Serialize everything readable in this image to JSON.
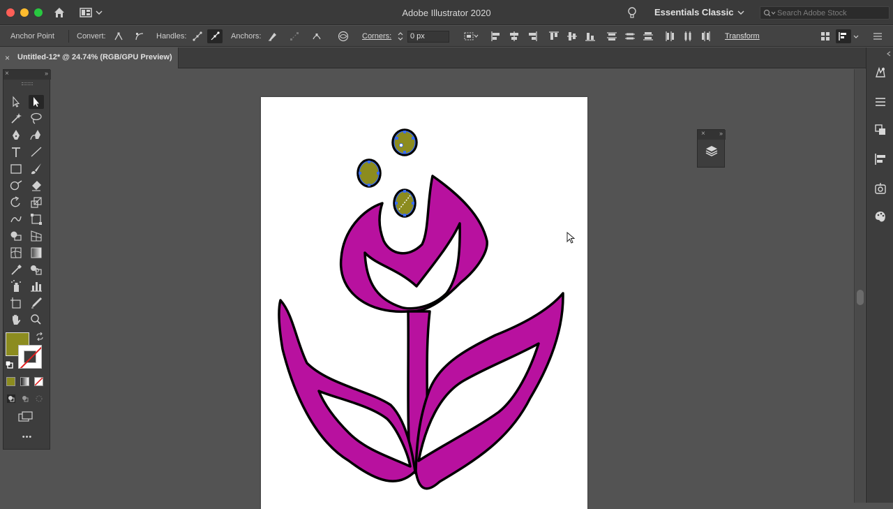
{
  "app": {
    "title": "Adobe Illustrator 2020",
    "workspace": "Essentials Classic",
    "search_placeholder": "Search Adobe Stock"
  },
  "control_bar": {
    "selection_type": "Anchor Point",
    "convert_label": "Convert:",
    "handles_label": "Handles:",
    "anchors_label": "Anchors:",
    "corners_label": "Corners:",
    "corners_value": "0 px",
    "transform_label": "Transform"
  },
  "document_tab": {
    "close": "×",
    "title": "Untitled-12* @ 24.74% (RGB/GPU Preview)"
  },
  "toolbar": {
    "close": "×",
    "collapse": "››",
    "more": "•••"
  },
  "layers_panel": {
    "close": "×",
    "collapse": "››"
  },
  "colors": {
    "fill": "#8c8c1f",
    "stroke": "none",
    "artwork_magenta": "#b8119f",
    "artwork_olive": "#8c8c1f",
    "selection_blue": "#3b6cf0"
  }
}
